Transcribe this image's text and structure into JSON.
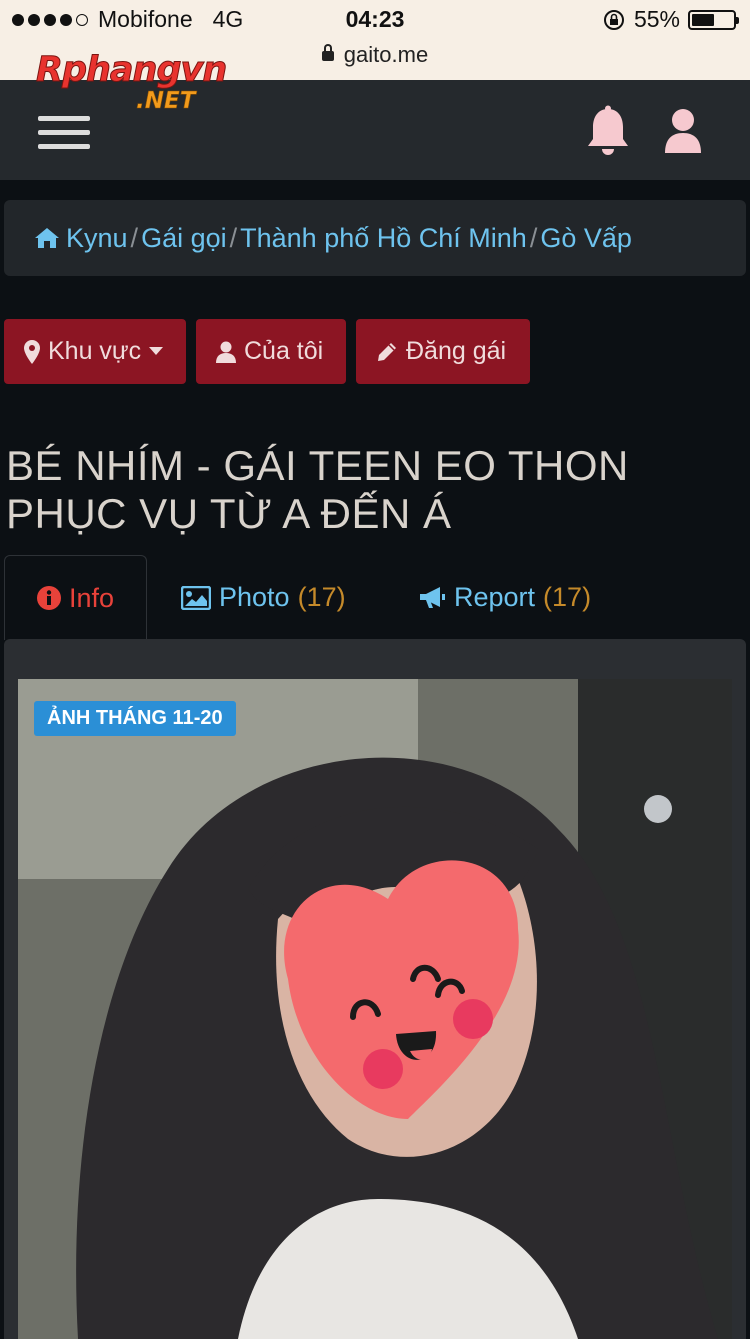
{
  "status_bar": {
    "carrier": "Mobifone",
    "network": "4G",
    "time": "04:23",
    "battery_percent": "55%",
    "battery_level": 0.55,
    "url": "gaito.me"
  },
  "logo": {
    "main": "Rphangvn",
    "sub": ".NET"
  },
  "breadcrumb": [
    "Kynu",
    "Gái gọi",
    "Thành phố Hồ Chí Minh",
    "Gò Vấp"
  ],
  "buttons": {
    "region": "Khu vực",
    "mine": "Của tôi",
    "post": "Đăng gái"
  },
  "title": "BÉ NHÍM - GÁI TEEN EO THON PHỤC VỤ TỪ A ĐẾN Á",
  "tabs": {
    "info": "Info",
    "photo": "Photo",
    "photo_count": "(17)",
    "report": "Report",
    "report_count": "(17)"
  },
  "photo_badge": "ẢNH THÁNG 11-20",
  "colors": {
    "header_bg": "#25292d",
    "button_bg": "#8c1523",
    "link": "#6ec3ee",
    "active_tab": "#e8423a",
    "badge": "#2b8fd6"
  }
}
